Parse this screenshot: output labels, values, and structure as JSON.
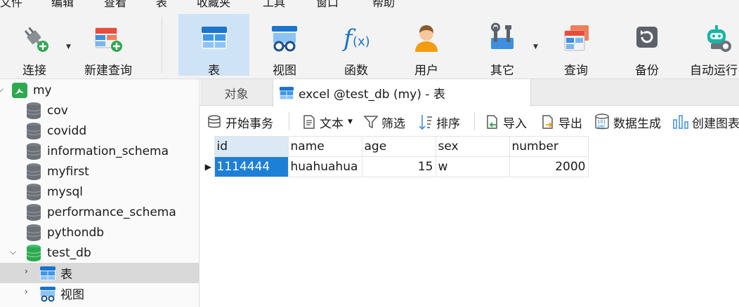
{
  "menu": [
    "文件",
    "编辑",
    "查看",
    "表",
    "收藏夹",
    "工具",
    "窗口",
    "帮助"
  ],
  "toolbar": {
    "buttons": [
      {
        "label": "连接",
        "icon": "plug-connect-icon"
      },
      {
        "label": "新建查询",
        "icon": "new-query-icon"
      },
      {
        "label": "表",
        "icon": "table-icon",
        "active": true
      },
      {
        "label": "视图",
        "icon": "view-icon"
      },
      {
        "label": "函数",
        "icon": "function-icon"
      },
      {
        "label": "用户",
        "icon": "user-icon"
      },
      {
        "label": "其它",
        "icon": "tools-icon"
      },
      {
        "label": "查询",
        "icon": "query-icon"
      },
      {
        "label": "备份",
        "icon": "backup-icon"
      },
      {
        "label": "自动运行",
        "icon": "robot-icon"
      }
    ]
  },
  "tree": {
    "connection": "my",
    "databases": [
      "cov",
      "covidd",
      "information_schema",
      "myfirst",
      "mysql",
      "performance_schema",
      "pythondb",
      "test_db"
    ],
    "children": [
      "表",
      "视图"
    ]
  },
  "tabs": {
    "objects": "对象",
    "active": "excel @test_db (my) - 表"
  },
  "subtoolbar": {
    "begin_transaction": "开始事务",
    "text": "文本",
    "filter": "筛选",
    "sort": "排序",
    "import": "导入",
    "export": "导出",
    "data_generation": "数据生成",
    "create_chart": "创建图表"
  },
  "grid": {
    "columns": [
      "id",
      "name",
      "age",
      "sex",
      "number"
    ],
    "rows": [
      [
        "1114444",
        "huahuahua",
        "15",
        "w",
        "2000"
      ]
    ]
  },
  "colors": {
    "accent": "#1e7fd6",
    "active_toolbar": "#cfe3f7",
    "selected_tree": "#d9d9d9"
  }
}
